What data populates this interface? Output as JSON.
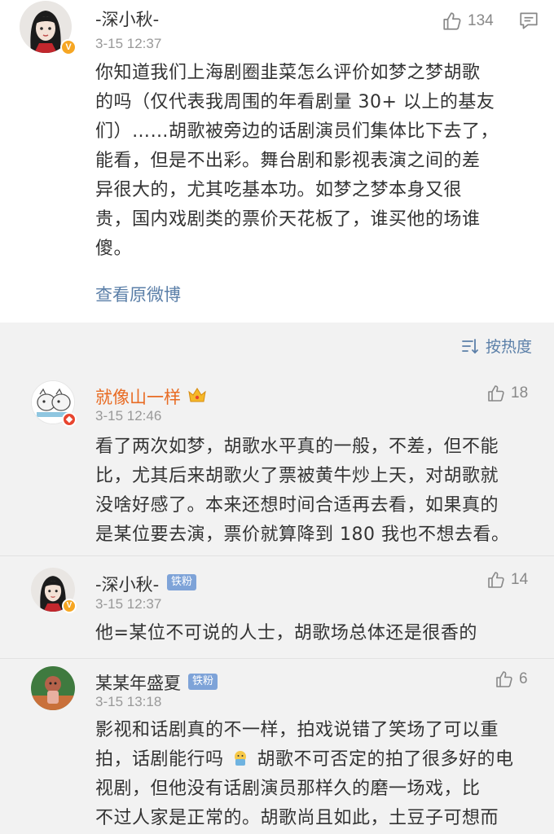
{
  "post": {
    "author": "-深小秋-",
    "time": "3-15 12:37",
    "likes": "134",
    "lines": [
      "你知道我们上海剧圈韭菜怎么评价如梦之梦胡歌",
      "的吗（仅代表我周围的年看剧量 30+ 以上的基友",
      "们）……胡歌被旁边的话剧演员们集体比下去了，",
      "能看，但是不出彩。舞台剧和影视表演之间的差",
      "异很大的，尤其吃基本功。如梦之梦本身又很",
      "贵，国内戏剧类的票价天花板了，谁买他的场谁",
      "傻。"
    ],
    "view_original": "查看原微博"
  },
  "sort_label": "按热度",
  "comments": [
    {
      "author": "就像山一样",
      "time": "3-15 12:46",
      "likes": "18",
      "lines": [
        "看了两次如梦，胡歌水平真的一般，不差，但不能",
        "比，尤其后来胡歌火了票被黄牛炒上天，对胡歌就",
        "没啥好感了。本来还想时间合适再去看，如果真的",
        "是某位要去演，票价就算降到 180 我也不想去看。"
      ]
    },
    {
      "author": "-深小秋-",
      "badge": "铁粉",
      "time": "3-15 12:37",
      "likes": "14",
      "lines": [
        "他=某位不可说的人士，胡歌场总体还是很香的"
      ]
    },
    {
      "author": "某某年盛夏",
      "badge": "铁粉",
      "time": "3-15 13:18",
      "likes": "6",
      "line1_before": "影视和话剧真的不一样，拍戏说错了笑场了可以重",
      "line2_before": "拍，话剧能行吗",
      "line2_after": "胡歌不可否定的拍了很多好的电",
      "lines_rest": [
        "视剧，但他没有话剧演员那样久的磨一场戏，比",
        "不过人家是正常的。胡歌尚且如此，土豆子可想而"
      ]
    }
  ],
  "colors": {
    "link_blue": "#5b7fa8",
    "orange_name": "#e86b23",
    "badge_blue": "#7ea3d8",
    "verified_gold": "#f6a623"
  },
  "icons": [
    "thumbs-up-icon",
    "comment-icon",
    "sort-icon",
    "verified-badge-icon",
    "crown-icon",
    "emoji-icon"
  ]
}
